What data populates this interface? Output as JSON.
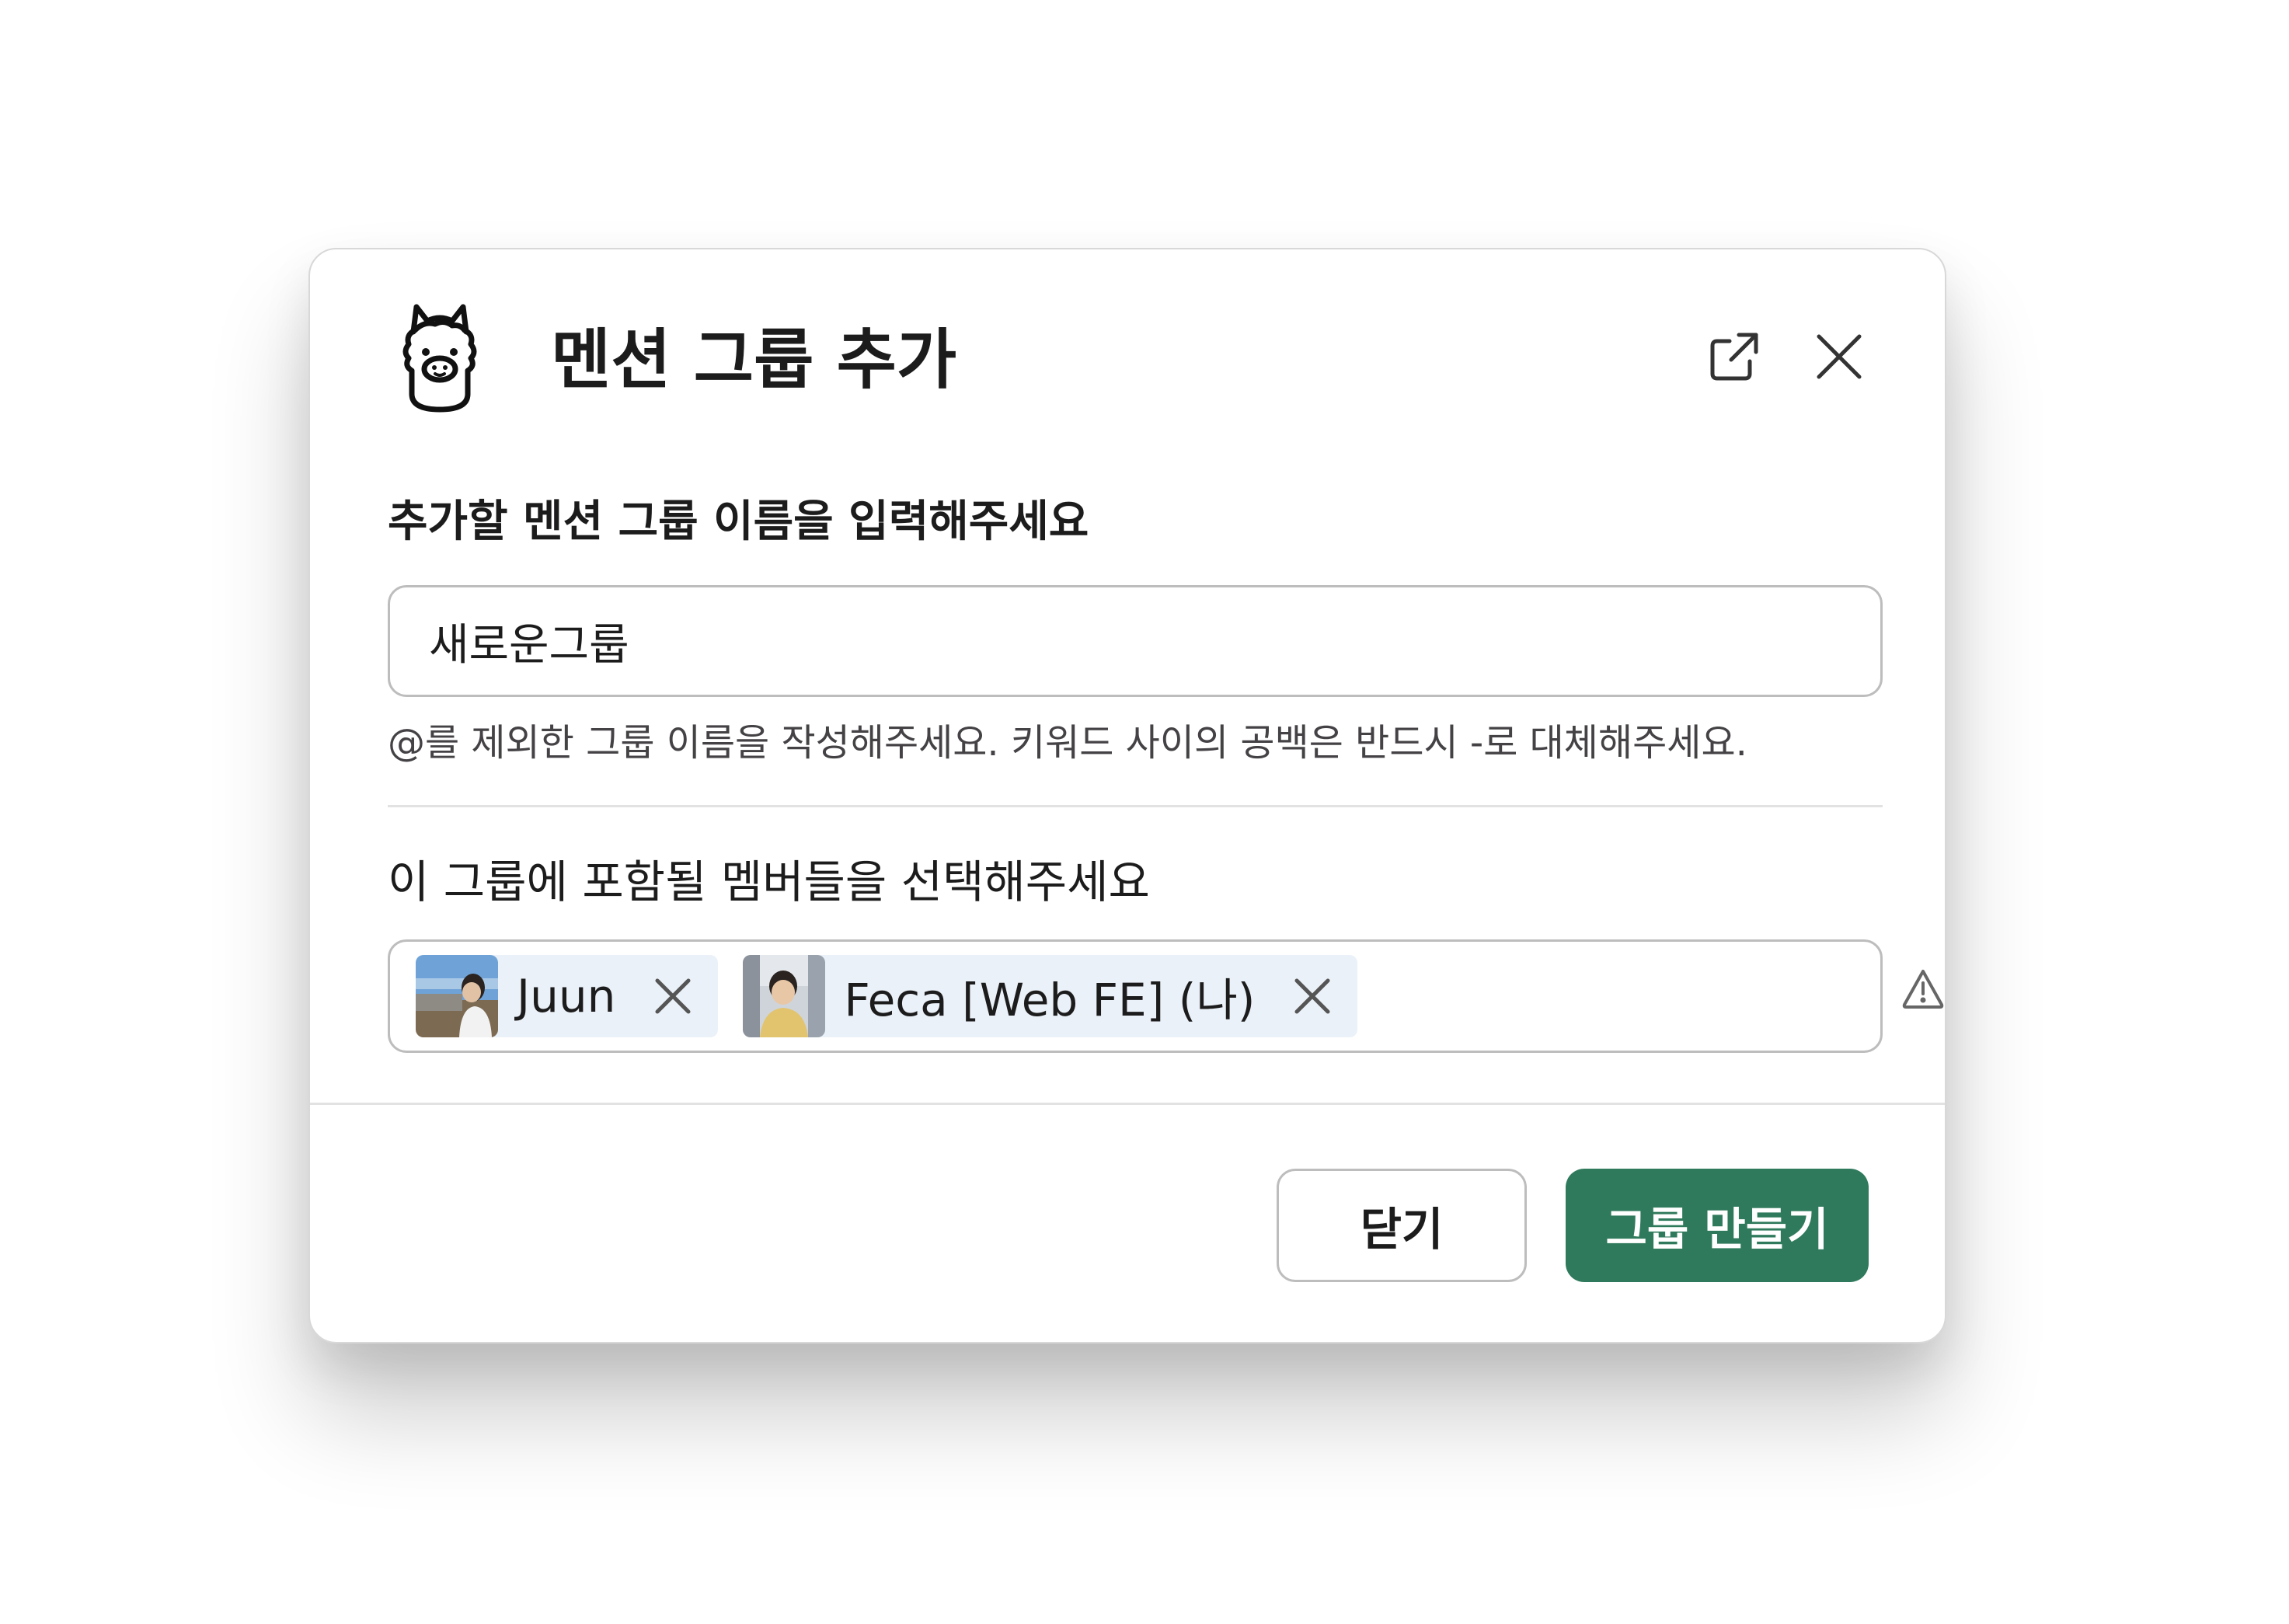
{
  "dialog": {
    "title": "멘션 그룹 추가",
    "logo_icon": "alpaca-logo-icon",
    "header_actions": [
      {
        "icon": "external-link-icon"
      },
      {
        "icon": "close-icon"
      }
    ]
  },
  "form": {
    "name_label": "추가할 멘션 그룹 이름을 입력해주세요",
    "name_value": "새로운그룹",
    "name_hint": "@를 제외한 그룹 이름을 작성해주세요. 키워드 사이의 공백은 반드시 -로 대체해주세요.",
    "members_label": "이 그룹에 포함될 멤버들을 선택해주세요",
    "members": [
      {
        "name": "Juun",
        "avatar": "photo-avatar"
      },
      {
        "name": "Feca [Web FE] (나)",
        "avatar": "photo-avatar"
      }
    ],
    "members_status_icon": "warning-icon"
  },
  "footer": {
    "close_label": "닫기",
    "create_label": "그룹 만들기"
  },
  "colors": {
    "primary": "#2f7a5c",
    "chip_bg": "#eaf1f8",
    "border": "#bdbdbd"
  }
}
